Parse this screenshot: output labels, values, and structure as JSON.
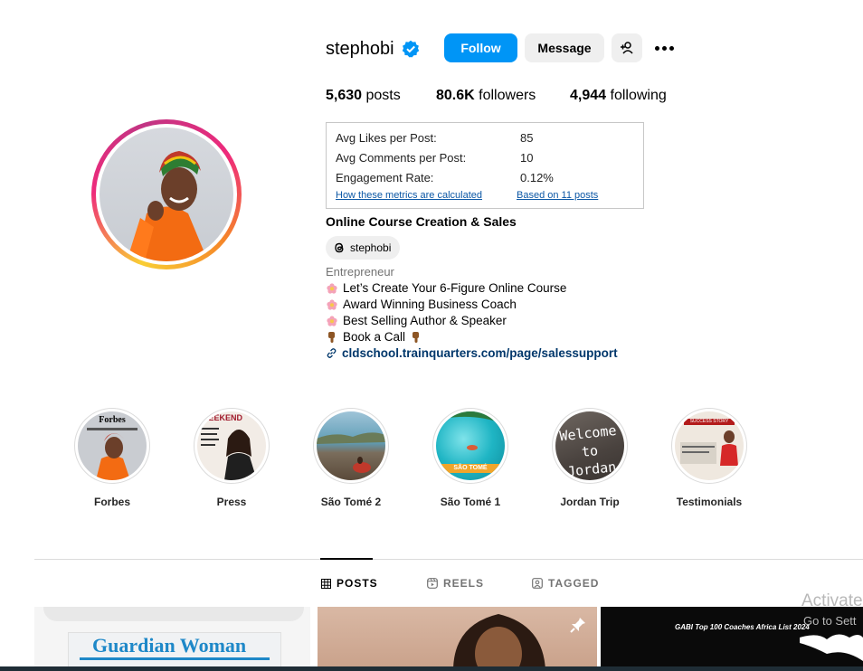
{
  "profile": {
    "username": "stephobi",
    "verified": true,
    "follow_label": "Follow",
    "message_label": "Message",
    "posts_count": "5,630",
    "posts_label": "posts",
    "followers_count": "80.6K",
    "followers_label": "followers",
    "following_count": "4,944",
    "following_label": "following"
  },
  "metrics": {
    "avg_likes_label": "Avg Likes per Post:",
    "avg_likes_value": "85",
    "avg_comments_label": "Avg Comments per Post:",
    "avg_comments_value": "10",
    "engagement_label": "Engagement Rate:",
    "engagement_value": "0.12%",
    "how_link": "How these metrics are calculated",
    "based_link": "Based on 11 posts"
  },
  "bio": {
    "category_title": "Online Course Creation & Sales",
    "threads_handle": "stephobi",
    "category": "Entrepreneur",
    "line1": "Let’s Create Your 6-Figure Online Course",
    "line2": "Award Winning Business Coach",
    "line3": "Best Selling Author & Speaker",
    "line4": "Book a Call",
    "link": "cldschool.trainquarters.com/page/salessupport"
  },
  "highlights": [
    {
      "label": "Forbes",
      "thumb_text": "Forbes"
    },
    {
      "label": "Press",
      "thumb_text": "WEEKEND"
    },
    {
      "label": "São Tomé 2"
    },
    {
      "label": "São Tomé 1",
      "thumb_text": "SÃO TOMÉ"
    },
    {
      "label": "Jordan Trip",
      "thumb_text": "Welcome to Jordan"
    },
    {
      "label": "Testimonials",
      "thumb_text": "SUCCESS STORY"
    }
  ],
  "tabs": {
    "posts": "POSTS",
    "reels": "REELS",
    "tagged": "TAGGED"
  },
  "posts": {
    "post1_text": "Guardian Woman",
    "post3_text": "GABI Top 100 Coaches Africa List 2024"
  },
  "overlay": {
    "activate": "Activate",
    "goto": "Go to Sett"
  },
  "colors": {
    "accent": "#0095f6",
    "link": "#00376b"
  }
}
